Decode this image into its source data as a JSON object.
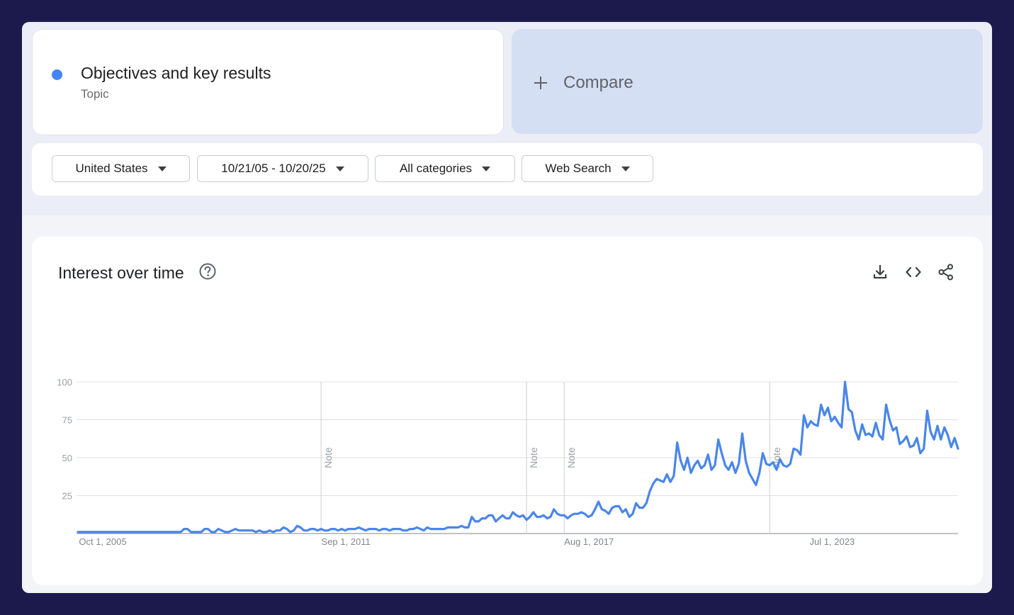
{
  "term": {
    "name": "Objectives and key results",
    "type": "Topic",
    "color": "#4285f4"
  },
  "compare": {
    "label": "Compare",
    "icon": "plus-icon"
  },
  "filters": {
    "region": "United States",
    "date_range": "10/21/05 - 10/20/25",
    "category": "All categories",
    "property": "Web Search"
  },
  "chart_section": {
    "title": "Interest over time",
    "help_icon": "help-circle-icon",
    "tools": [
      "download-icon",
      "embed-code-icon",
      "share-icon"
    ]
  },
  "chart_data": {
    "type": "line",
    "series": [
      {
        "values": [
          1,
          1,
          1,
          1,
          1,
          1,
          1,
          1,
          1,
          1,
          1,
          1,
          1,
          1,
          1,
          1,
          1,
          1,
          1,
          1,
          1,
          1,
          1,
          1,
          1,
          1,
          1,
          1,
          1,
          1,
          1,
          3,
          3,
          1,
          1,
          1,
          1,
          3,
          3,
          1,
          1,
          3,
          2,
          1,
          1,
          2,
          3,
          2,
          2,
          2,
          2,
          2,
          1,
          2,
          1,
          1,
          2,
          1,
          2,
          2,
          4,
          3,
          1,
          2,
          5,
          4,
          2,
          2,
          3,
          3,
          2,
          3,
          2,
          2,
          3,
          3,
          2,
          3,
          2,
          3,
          3,
          3,
          4,
          3,
          2,
          3,
          3,
          3,
          2,
          3,
          3,
          2,
          3,
          3,
          3,
          2,
          2,
          3,
          3,
          4,
          3,
          2,
          4,
          3,
          3,
          3,
          3,
          3,
          4,
          4,
          4,
          4,
          5,
          4,
          4,
          11,
          8,
          8,
          10,
          10,
          12,
          12,
          8,
          10,
          12,
          10,
          10,
          14,
          12,
          11,
          12,
          9,
          11,
          14,
          11,
          11,
          12,
          10,
          11,
          16,
          13,
          12,
          12,
          10,
          12,
          13,
          13,
          14,
          13,
          11,
          12,
          16,
          21,
          16,
          15,
          13,
          17,
          18,
          18,
          14,
          16,
          11,
          13,
          20,
          17,
          17,
          20,
          28,
          33,
          36,
          35,
          34,
          39,
          34,
          38,
          60,
          48,
          42,
          50,
          40,
          45,
          48,
          43,
          45,
          52,
          42,
          45,
          62,
          53,
          45,
          42,
          47,
          40,
          46,
          66,
          48,
          40,
          36,
          32,
          40,
          53,
          46,
          45,
          47,
          42,
          49,
          45,
          44,
          46,
          56,
          55,
          52,
          78,
          70,
          74,
          72,
          71,
          85,
          78,
          83,
          74,
          77,
          73,
          70,
          100,
          82,
          80,
          68,
          62,
          72,
          65,
          66,
          64,
          73,
          65,
          62,
          85,
          75,
          68,
          70,
          59,
          61,
          64,
          57,
          58,
          63,
          53,
          56,
          81,
          67,
          62,
          71,
          62,
          70,
          65,
          57,
          63,
          56
        ]
      }
    ],
    "x_ticks": [
      "Oct 1, 2005",
      "Sep 1, 2011",
      "Aug 1, 2017",
      "Jul 1, 2023"
    ],
    "x_tick_months": [
      0,
      71,
      142,
      213
    ],
    "y_ticks": [
      100,
      75,
      50,
      25
    ],
    "ylim": [
      0,
      100
    ],
    "note_months": [
      71,
      131,
      142,
      202
    ],
    "note_label": "Note",
    "grid": true,
    "line_color": "#4a86e8"
  }
}
